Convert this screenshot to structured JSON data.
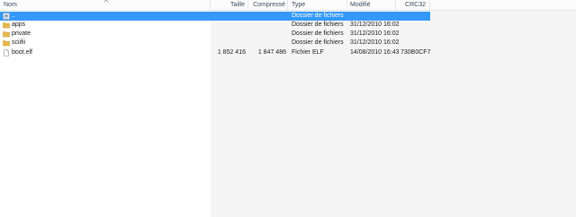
{
  "columns": {
    "name": "Nom",
    "size": "Taille",
    "compressed": "Compressé",
    "type": "Type",
    "modified": "Modifié",
    "crc": "CRC32"
  },
  "rows": [
    {
      "name": "..",
      "size": "",
      "compressed": "",
      "type": "Dossier de fichiers",
      "modified": "",
      "crc": "",
      "icon": "up-folder-icon",
      "selected": true
    },
    {
      "name": "apps",
      "size": "",
      "compressed": "",
      "type": "Dossier de fichiers",
      "modified": "31/12/2010 16:02",
      "crc": "",
      "icon": "folder-icon",
      "selected": false
    },
    {
      "name": "private",
      "size": "",
      "compressed": "",
      "type": "Dossier de fichiers",
      "modified": "31/12/2010 16:02",
      "crc": "",
      "icon": "folder-icon",
      "selected": false
    },
    {
      "name": "sciifii",
      "size": "",
      "compressed": "",
      "type": "Dossier de fichiers",
      "modified": "31/12/2010 16:02",
      "crc": "",
      "icon": "folder-icon",
      "selected": false
    },
    {
      "name": "boot.elf",
      "size": "1 852 416",
      "compressed": "1 847 486",
      "type": "Fichier ELF",
      "modified": "14/08/2010 16:43",
      "crc": "730B0CF7",
      "icon": "file-icon",
      "selected": false
    }
  ],
  "colors": {
    "selection": "#3399ff",
    "folder": "#e8b84a",
    "header_text": "#3a4a5c"
  }
}
